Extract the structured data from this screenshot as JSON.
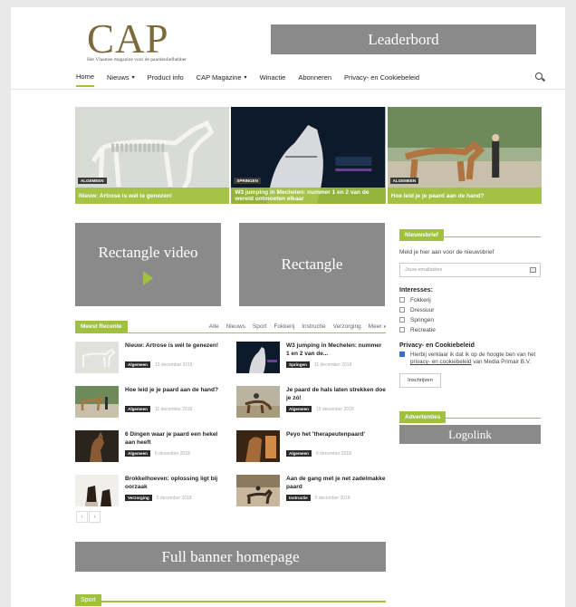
{
  "header": {
    "logo_text": "CAP",
    "logo_tagline": "Het Vlaamse magazine voor de paardenliefhebber",
    "ad_leaderboard": "Leaderbord"
  },
  "nav": {
    "items": [
      {
        "label": "Home",
        "active": true
      },
      {
        "label": "Nieuws",
        "dropdown": true
      },
      {
        "label": "Product info"
      },
      {
        "label": "CAP Magazine",
        "dropdown": true
      },
      {
        "label": "Winactie"
      },
      {
        "label": "Abonneren"
      },
      {
        "label": "Privacy- en Cookiebeleid"
      }
    ],
    "search_icon": "search-icon"
  },
  "hero": [
    {
      "category": "ALGEMEEN",
      "caption": "Nieuw: Artrose is wél te genezen!"
    },
    {
      "category": "SPRINGEN",
      "caption": "W3 jumping in Mechelen: nummer 1 en 2 van de wereld ontmoeten elkaar"
    },
    {
      "category": "ALGEMEEN",
      "caption": "Hoe leid je je paard aan de hand?"
    }
  ],
  "ads": {
    "rect_video": "Rectangle video",
    "rect": "Rectangle",
    "full_banner": "Full banner homepage",
    "logolink": "Logolink"
  },
  "recent": {
    "label": "Meest Recente",
    "filters": [
      "Alle",
      "Nieuws",
      "Sport",
      "Fokkerij",
      "Instructie",
      "Verzorging"
    ],
    "more": "Meer",
    "posts": [
      {
        "title": "Nieuw: Artrose is wél te genezen!",
        "category": "Algemeen",
        "date": "13 december 2018"
      },
      {
        "title": "W3 jumping in Mechelen: nummer 1 en 2 van de...",
        "category": "Springen",
        "date": "11 december 2018"
      },
      {
        "title": "Hoe leid je je paard aan de hand?",
        "category": "Algemeen",
        "date": "11 december 2018"
      },
      {
        "title": "Je paard de hals laten strekken doe je zó!",
        "category": "Algemeen",
        "date": "10 december 2018"
      },
      {
        "title": "6 Dingen waar je paard een hekel aan heeft",
        "category": "Algemeen",
        "date": "6 december 2018"
      },
      {
        "title": "Peyo het 'therapeutenpaard'",
        "category": "Algemeen",
        "date": "6 december 2018"
      },
      {
        "title": "Brokkelhoeven: oplossing ligt bij oorzaak",
        "category": "Verzorging",
        "date": "5 december 2018"
      },
      {
        "title": "Aan de gang met je net zadelmakke paard",
        "category": "Instructie",
        "date": "5 december 2018"
      }
    ]
  },
  "pager": {
    "prev": "‹",
    "next": "›"
  },
  "sport": {
    "label": "Sport"
  },
  "sidebar": {
    "newsletter_title": "Nieuwsbrief",
    "newsletter_intro": "Meld je hier aan voor de nieuwsbrief",
    "email_placeholder": "Jouw emailadres",
    "interests_title": "Interesses:",
    "interests": [
      "Fokkerij",
      "Dressuur",
      "Springen",
      "Recreatie"
    ],
    "privacy_title": "Privacy- en Cookiebeleid",
    "privacy_text": "Hierbij verklaar ik dat ik op de hoogte ben van het",
    "privacy_link": "privacy- en cookiebeleid",
    "privacy_text_end": "van Media Primair B.V.",
    "subscribe_label": "Inschrijven",
    "ads_title": "Advertenties"
  },
  "colors": {
    "accent": "#9fc13b",
    "ad_grey": "#8a8a8a"
  }
}
